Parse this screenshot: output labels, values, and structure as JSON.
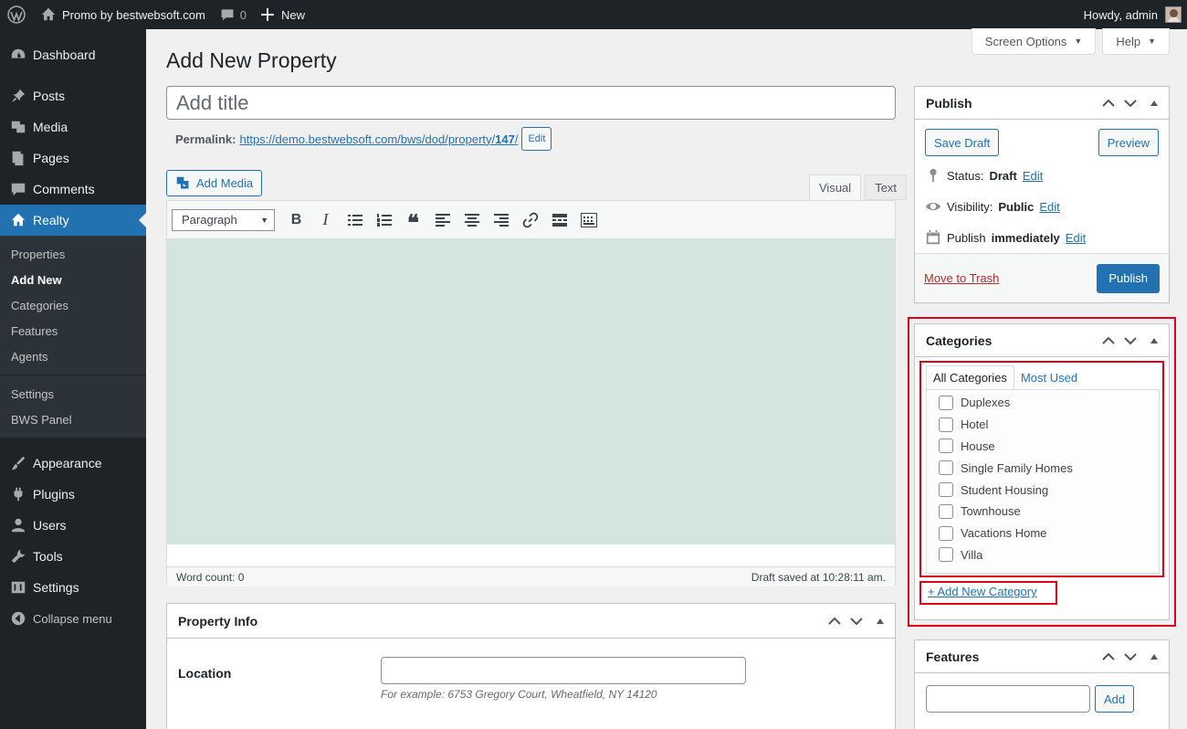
{
  "adminbar": {
    "site_name": "Promo by bestwebsoft.com",
    "comments_count": "0",
    "new_label": "New",
    "greeting": "Howdy, admin"
  },
  "sidebar": {
    "items": [
      {
        "label": "Dashboard",
        "icon": "dashboard-icon"
      },
      {
        "label": "Posts",
        "icon": "pin-icon"
      },
      {
        "label": "Media",
        "icon": "media-icon"
      },
      {
        "label": "Pages",
        "icon": "pages-icon"
      },
      {
        "label": "Comments",
        "icon": "comment-icon"
      },
      {
        "label": "Realty",
        "icon": "home-icon"
      }
    ],
    "submenu": [
      "Properties",
      "Add New",
      "Categories",
      "Features",
      "Agents",
      "Settings",
      "BWS Panel"
    ],
    "items_bottom": [
      {
        "label": "Appearance",
        "icon": "brush-icon"
      },
      {
        "label": "Plugins",
        "icon": "plugin-icon"
      },
      {
        "label": "Users",
        "icon": "user-icon"
      },
      {
        "label": "Tools",
        "icon": "wrench-icon"
      },
      {
        "label": "Settings",
        "icon": "settings-icon"
      },
      {
        "label": "Collapse menu",
        "icon": "collapse-icon"
      }
    ]
  },
  "screen_meta": {
    "screen_options": "Screen Options",
    "help": "Help"
  },
  "page": {
    "title": "Add New Property",
    "title_placeholder": "Add title",
    "permalink_label": "Permalink:",
    "permalink_url": "https://demo.bestwebsoft.com/bws/dod/property/",
    "permalink_slug": "147",
    "permalink_trail": "/",
    "edit_label": "Edit"
  },
  "editor": {
    "add_media": "Add Media",
    "tab_visual": "Visual",
    "tab_text": "Text",
    "format": "Paragraph",
    "word_count": "Word count: 0",
    "draft_saved": "Draft saved at 10:28:11 am."
  },
  "property_info": {
    "title": "Property Info",
    "location_label": "Location",
    "location_value": "",
    "location_hint": "For example: 6753 Gregory Court, Wheatfield, NY 14120"
  },
  "publish": {
    "title": "Publish",
    "save_draft": "Save Draft",
    "preview": "Preview",
    "status_label": "Status:",
    "status_value": "Draft",
    "visibility_label": "Visibility:",
    "visibility_value": "Public",
    "publish_label": "Publish",
    "publish_value": "immediately",
    "edit": "Edit",
    "move_to_trash": "Move to Trash",
    "publish_button": "Publish"
  },
  "categories": {
    "title": "Categories",
    "tab_all": "All Categories",
    "tab_most_used": "Most Used",
    "items": [
      "Duplexes",
      "Hotel",
      "House",
      "Single Family Homes",
      "Student Housing",
      "Townhouse",
      "Vacations Home",
      "Villa"
    ],
    "add_new": "+ Add New Category"
  },
  "features": {
    "title": "Features",
    "add_button": "Add",
    "input_value": ""
  },
  "colors": {
    "accent": "#2271b1",
    "highlight": "#e0001a",
    "editor_bg": "#d3e5de"
  }
}
